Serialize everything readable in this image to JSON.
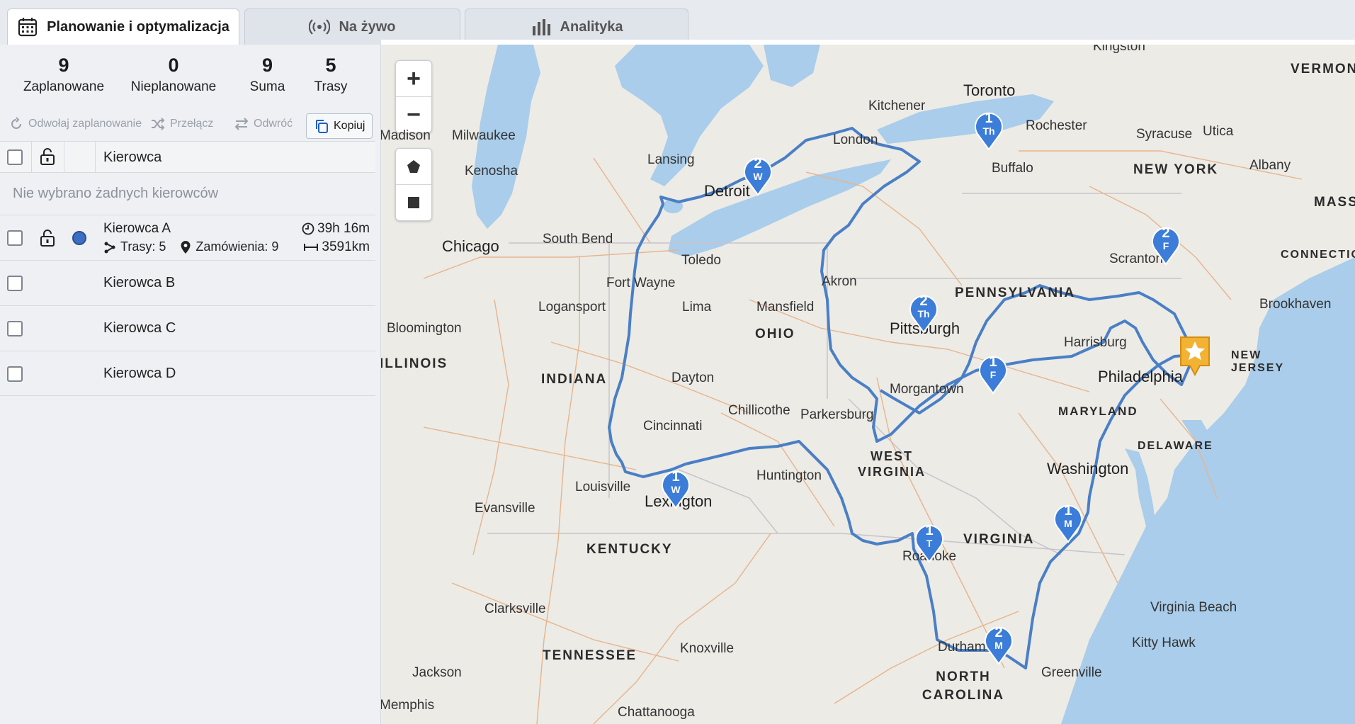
{
  "tabs": [
    {
      "label": "Planowanie i optymalizacja",
      "icon": "calendar-icon",
      "active": true
    },
    {
      "label": "Na żywo",
      "icon": "live-signal-icon",
      "active": false
    },
    {
      "label": "Analityka",
      "icon": "bar-chart-icon",
      "active": false
    }
  ],
  "stats": [
    {
      "value": "9",
      "label": "Zaplanowane"
    },
    {
      "value": "0",
      "label": "Nieplanowane"
    },
    {
      "value": "9",
      "label": "Suma"
    },
    {
      "value": "5",
      "label": "Trasy"
    }
  ],
  "toolbar": {
    "unschedule": "Odwołaj zaplanowanie",
    "toggle": "Przełącz",
    "reverse": "Odwróć",
    "copy": "Kopiuj"
  },
  "table": {
    "header": "Kierowca",
    "empty_message": "Nie wybrano żadnych kierowców",
    "drivers": [
      {
        "name": "Kierowca A",
        "routes": "Trasy: 5",
        "orders": "Zamówienia: 9",
        "duration": "39h 16m",
        "distance": "3591km",
        "color": "#3c6fc2"
      },
      {
        "name": "Kierowca B"
      },
      {
        "name": "Kierowca C"
      },
      {
        "name": "Kierowca D"
      }
    ]
  },
  "map": {
    "zoom_in": "+",
    "zoom_out": "−",
    "route_color": "#4a7fc6",
    "pin_color": "#3b7dd8",
    "depot_color": "#f2b233",
    "water_color": "#a9cdea",
    "land_color": "#ecebe6",
    "cities": [
      "Kingston",
      "Toronto",
      "Kitchener",
      "London",
      "Rochester",
      "Syracuse",
      "Utica",
      "Albany",
      "Buffalo",
      "Milwaukee",
      "Madison",
      "Lansing",
      "Kenosha",
      "Detroit",
      "Chicago",
      "South Bend",
      "Toledo",
      "Fort Wayne",
      "Akron",
      "Mansfield",
      "Logansport",
      "Lima",
      "Pittsburgh",
      "Harrisburg",
      "Scranton",
      "Brookhaven",
      "Bloomington",
      "Dayton",
      "Philadelphia",
      "Morgantown",
      "Chillicothe",
      "Parkersburg",
      "Cincinnati",
      "Huntington",
      "Washington",
      "Louisville",
      "Lexington",
      "Evansville",
      "Roanoke",
      "Clarksville",
      "Virginia Beach",
      "Kitty Hawk",
      "Durham",
      "Knoxville",
      "Greenville",
      "Jackson",
      "Memphis",
      "Chattanooga"
    ],
    "cities_big": [
      "Toronto",
      "Chicago",
      "Detroit",
      "Pittsburgh",
      "Philadelphia",
      "Washington",
      "Lexington"
    ],
    "states": [
      "NEW YORK",
      "VERMONT",
      "MASSA",
      "CONNECTIC",
      "PENNSYLVANIA",
      "NEW JERSEY",
      "OHIO",
      "INDIANA",
      "ILLINOIS",
      "MARYLAND",
      "DELAWARE",
      "WEST VIRGINIA",
      "KENTUCKY",
      "VIRGINIA",
      "TENNESSEE",
      "NORTH CAROLINA"
    ],
    "stops": [
      {
        "num": "1",
        "day": "Th"
      },
      {
        "num": "2",
        "day": "W"
      },
      {
        "num": "2",
        "day": "F"
      },
      {
        "num": "2",
        "day": "Th"
      },
      {
        "num": "1",
        "day": "F"
      },
      {
        "num": "1",
        "day": "W"
      },
      {
        "num": "1",
        "day": "T"
      },
      {
        "num": "1",
        "day": "M"
      },
      {
        "num": "2",
        "day": "M"
      }
    ]
  }
}
